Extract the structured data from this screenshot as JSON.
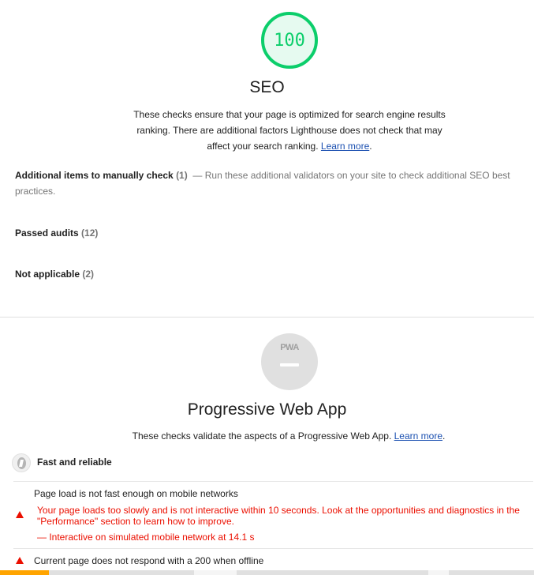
{
  "seo": {
    "score": "100",
    "title": "SEO",
    "description": "These checks ensure that your page is optimized for search engine results ranking. There are additional factors Lighthouse does not check that may affect your search ranking.",
    "learn_more": "Learn more",
    "groups": {
      "manual": {
        "title": "Additional items to manually check",
        "count": "(1)",
        "description": "— Run these additional validators on your site to check additional SEO best practices."
      },
      "passed": {
        "title": "Passed audits",
        "count": "(12)"
      },
      "not_applicable": {
        "title": "Not applicable",
        "count": "(2)"
      }
    }
  },
  "pwa": {
    "badge_text": "PWA",
    "title": "Progressive Web App",
    "description": "These checks validate the aspects of a Progressive Web App.",
    "learn_more": "Learn more",
    "group_fast_reliable": "Fast and reliable",
    "audits": [
      {
        "title": "Page load is not fast enough on mobile networks",
        "description_line1": "Your page loads too slowly and is not interactive within 10 seconds. Look at the opportunities and diagnostics in the",
        "description_line2": "\"Performance\" section to learn how to improve.",
        "note": "— Interactive on simulated mobile network at 14.1 s"
      },
      {
        "title": "Current page does not respond with a 200 when offline"
      }
    ]
  },
  "colors": {
    "pass": "#0cce6b",
    "fail": "#eb0f00",
    "link": "#1a4fb0"
  }
}
